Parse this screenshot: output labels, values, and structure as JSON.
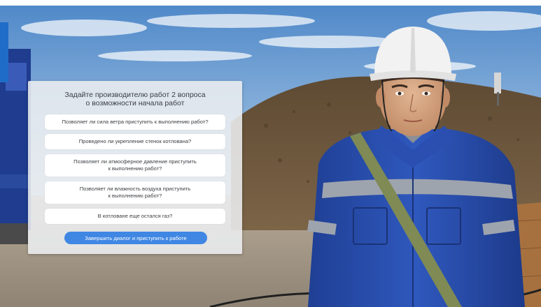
{
  "dialog": {
    "title": "Задайте производителю работ 2 вопроса\nо возможности начала работ",
    "options": [
      "Позволяет ли сила ветра приступить к выполнению работ?",
      "Проведено ли укрепление стенок котлована?",
      "Позволяет ли атмосферное давление приступить\nк выполнению работ?",
      "Позволяет ли влажность воздуха приступить\nк выполнению работ?",
      "В котловане еще остался газ?"
    ],
    "finish_button": "Завершить диалог и приступить к работе"
  },
  "colors": {
    "button_accent": "#3f87e3",
    "panel_bg": "#eceef0",
    "uniform_blue": "#2a4fb0",
    "helmet_white": "#f2f2f2"
  }
}
